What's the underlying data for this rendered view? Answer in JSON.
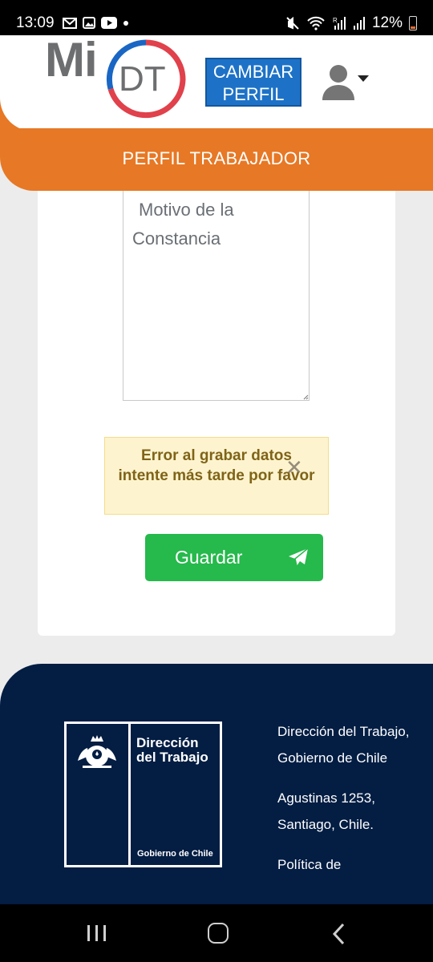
{
  "status_bar": {
    "time": "13:09",
    "battery": "12%",
    "left_icons": [
      "gmail-icon",
      "gallery-icon",
      "youtube-icon",
      "dot-icon"
    ],
    "right_icons": [
      "mute-icon",
      "wifi-icon",
      "signal-r-icon",
      "signal-icon",
      "battery-icon"
    ]
  },
  "header": {
    "logo_mi": "Mi",
    "logo_dt": "DT",
    "cambiar_line1": "CAMBIAR",
    "cambiar_line2": "PERFIL",
    "user_icon": "user-icon"
  },
  "banner": {
    "title": "PERFIL TRABAJADOR"
  },
  "form": {
    "motivo_line1": "Motivo de la",
    "motivo_line2": "Constancia",
    "alert_text": "Error al grabar datos intente más tarde por favor",
    "alert_close": "✕",
    "save_label": "Guardar",
    "save_icon": "send-icon"
  },
  "footer": {
    "logo_line1": "Dirección",
    "logo_line2": "del Trabajo",
    "logo_sub": "Gobierno de Chile",
    "text1": "Dirección del Trabajo, Gobierno de Chile",
    "text2": "Agustinas 1253, Santiago, Chile.",
    "text3": "Política de"
  },
  "colors": {
    "orange": "#e77825",
    "blue_button": "#1d72c7",
    "green_button": "#26b94c",
    "footer_navy": "#031d43",
    "alert_bg": "#fdf4cf"
  }
}
